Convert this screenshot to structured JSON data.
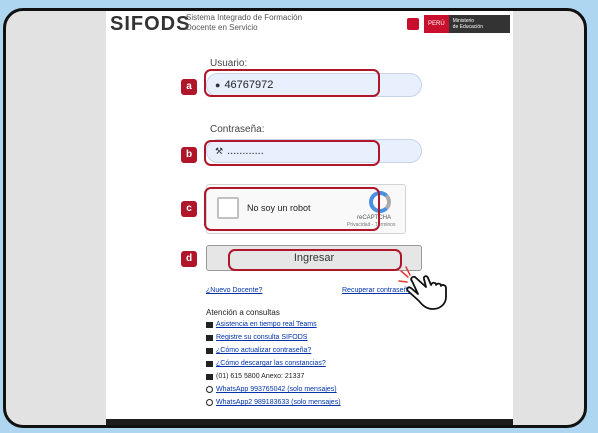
{
  "brand": {
    "name": "SIFODS",
    "subtitle_line1": "Sistema Integrado de Formación",
    "subtitle_line2": "Docente en Servicio",
    "peru_label": "PERÚ",
    "ministry_line1": "Ministerio",
    "ministry_line2": "de Educación"
  },
  "form": {
    "user_label": "Usuario:",
    "user_value": "46767972",
    "password_label": "Contraseña:",
    "password_value": "............",
    "captcha_text": "No soy un robot",
    "captcha_brand": "reCAPTCHA",
    "captcha_terms": "Privacidad - Términos",
    "login_label": "Ingresar"
  },
  "links": {
    "new_teacher": "¿Nuevo Docente?",
    "recover_password": "Recuperar contraseña"
  },
  "support": {
    "title": "Atención a consultas",
    "items": [
      {
        "icon": "video-icon",
        "text": "Asistencia en tiempo real Teams"
      },
      {
        "icon": "document-icon",
        "text": "Registre su consulta SIFODS"
      },
      {
        "icon": "film-icon",
        "text": "¿Cómo actualizar contraseña?"
      },
      {
        "icon": "film-icon",
        "text": "¿Cómo descargar las constancias?"
      },
      {
        "icon": "phone-icon",
        "text": "(01) 615 5800 Anexo: 21337"
      },
      {
        "icon": "whatsapp-icon",
        "text": "WhatsApp 993765042 (solo mensajes)"
      },
      {
        "icon": "whatsapp-icon",
        "text": "WhatsApp2 989183633 (solo mensajes)"
      }
    ]
  },
  "annotations": {
    "a": "a",
    "b": "b",
    "c": "c",
    "d": "d"
  },
  "colors": {
    "background": "#aed6f1",
    "highlight": "#b0162a",
    "field": "#e8f0fe",
    "link": "#0033aa"
  }
}
